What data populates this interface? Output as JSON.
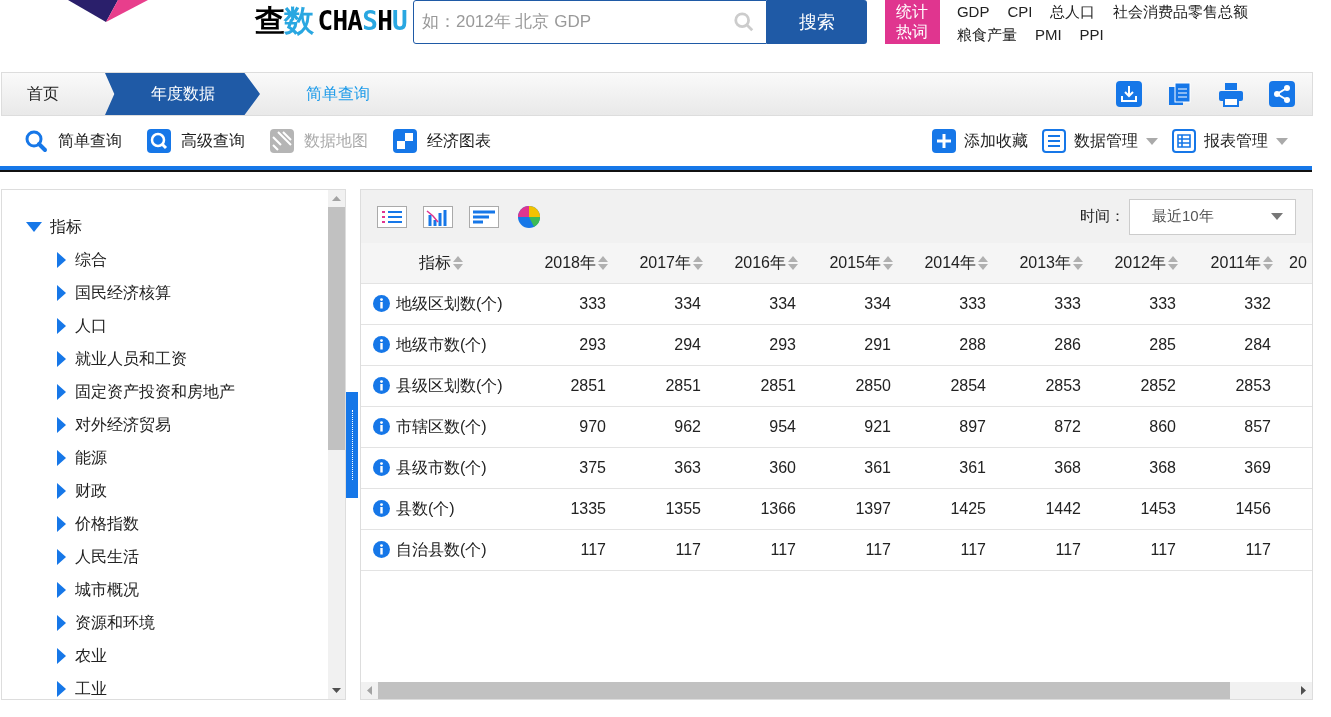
{
  "header": {
    "logo_text": {
      "part1": "查",
      "part2": "数",
      "part3": "CHA",
      "part4": "S",
      "part5": "H",
      "part6": "U"
    },
    "search": {
      "placeholder": "如：2012年 北京 GDP",
      "button": "搜索"
    },
    "hot_badge": [
      "统计",
      "热词"
    ],
    "hot_words": [
      [
        "GDP",
        "CPI",
        "总人口",
        "社会消费品零售总额"
      ],
      [
        "粮食产量",
        "PMI",
        "PPI"
      ]
    ]
  },
  "breadcrumb": [
    {
      "label": "首页",
      "kind": "link"
    },
    {
      "label": "年度数据",
      "kind": "active"
    },
    {
      "label": "简单查询",
      "kind": "current"
    }
  ],
  "toolbar": {
    "left": [
      {
        "label": "简单查询",
        "disabled": false
      },
      {
        "label": "高级查询",
        "disabled": false
      },
      {
        "label": "数据地图",
        "disabled": true
      },
      {
        "label": "经济图表",
        "disabled": false
      }
    ],
    "right": [
      {
        "label": "添加收藏",
        "dropdown": false
      },
      {
        "label": "数据管理",
        "dropdown": true
      },
      {
        "label": "报表管理",
        "dropdown": true
      }
    ]
  },
  "tree": {
    "label": "指标",
    "expanded": true,
    "children": [
      {
        "label": "综合",
        "expanded": false
      },
      {
        "label": "国民经济核算",
        "expanded": false
      },
      {
        "label": "人口",
        "expanded": false
      },
      {
        "label": "就业人员和工资",
        "expanded": false
      },
      {
        "label": "固定资产投资和房地产",
        "expanded": false
      },
      {
        "label": "对外经济贸易",
        "expanded": false
      },
      {
        "label": "能源",
        "expanded": false
      },
      {
        "label": "财政",
        "expanded": false
      },
      {
        "label": "价格指数",
        "expanded": false
      },
      {
        "label": "人民生活",
        "expanded": false
      },
      {
        "label": "城市概况",
        "expanded": false
      },
      {
        "label": "资源和环境",
        "expanded": false
      },
      {
        "label": "农业",
        "expanded": false
      },
      {
        "label": "工业",
        "expanded": false
      }
    ]
  },
  "time_filter": {
    "label": "时间：",
    "value": "最近10年"
  },
  "table": {
    "columns": [
      "指标",
      "2018年",
      "2017年",
      "2016年",
      "2015年",
      "2014年",
      "2013年",
      "2012年",
      "2011年",
      "20"
    ],
    "rows": [
      [
        "地级区划数(个)",
        "333",
        "334",
        "334",
        "334",
        "333",
        "333",
        "333",
        "332"
      ],
      [
        "地级市数(个)",
        "293",
        "294",
        "293",
        "291",
        "288",
        "286",
        "285",
        "284"
      ],
      [
        "县级区划数(个)",
        "2851",
        "2851",
        "2851",
        "2850",
        "2854",
        "2853",
        "2852",
        "2853"
      ],
      [
        "市辖区数(个)",
        "970",
        "962",
        "954",
        "921",
        "897",
        "872",
        "860",
        "857"
      ],
      [
        "县级市数(个)",
        "375",
        "363",
        "360",
        "361",
        "361",
        "368",
        "368",
        "369"
      ],
      [
        "县数(个)",
        "1335",
        "1355",
        "1366",
        "1397",
        "1425",
        "1442",
        "1453",
        "1456"
      ],
      [
        "自治县数(个)",
        "117",
        "117",
        "117",
        "117",
        "117",
        "117",
        "117",
        "117"
      ]
    ]
  }
}
